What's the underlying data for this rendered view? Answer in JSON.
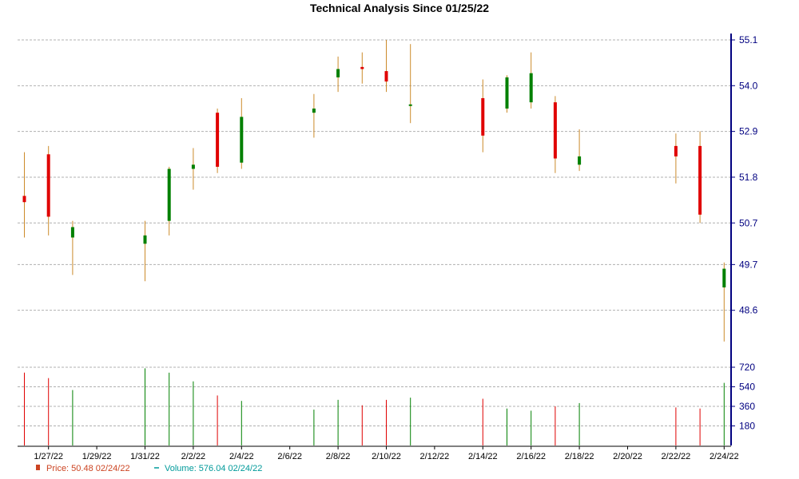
{
  "chart_data": {
    "type": "candlestick",
    "title": "Technical Analysis Since 01/25/22",
    "colors": {
      "up": "#008000",
      "down": "#e00000",
      "wick": "#cc8a2a",
      "grid": "#b0b0b0",
      "axis": "#000080"
    },
    "price_axis": {
      "ylim": [
        47.5,
        55.1
      ],
      "ticks": [
        "55.1",
        "54.0",
        "52.9",
        "51.8",
        "50.7",
        "49.7",
        "48.6"
      ]
    },
    "volume_axis": {
      "ylim": [
        0,
        720
      ],
      "ticks": [
        "720",
        "540",
        "360",
        "180"
      ]
    },
    "x_tick_labels": [
      "1/27/22",
      "1/29/22",
      "1/31/22",
      "2/2/22",
      "2/4/22",
      "2/6/22",
      "2/8/22",
      "2/10/22",
      "2/12/22",
      "2/14/22",
      "2/16/22",
      "2/18/22",
      "2/20/22",
      "2/22/22",
      "2/24/22"
    ],
    "candles": [
      {
        "date": "1/26/22",
        "open": 51.35,
        "high": 52.4,
        "low": 50.35,
        "close": 51.2,
        "volume": 670
      },
      {
        "date": "1/27/22",
        "open": 52.35,
        "high": 52.55,
        "low": 50.4,
        "close": 50.85,
        "volume": 620
      },
      {
        "date": "1/28/22",
        "open": 50.35,
        "high": 50.75,
        "low": 49.45,
        "close": 50.6,
        "volume": 510
      },
      {
        "date": "1/31/22",
        "open": 50.2,
        "high": 50.75,
        "low": 49.3,
        "close": 50.4,
        "volume": 710
      },
      {
        "date": "2/1/22",
        "open": 50.75,
        "high": 52.05,
        "low": 50.4,
        "close": 52.0,
        "volume": 670
      },
      {
        "date": "2/2/22",
        "open": 52.0,
        "high": 52.5,
        "low": 51.5,
        "close": 52.1,
        "volume": 590
      },
      {
        "date": "2/3/22",
        "open": 53.35,
        "high": 53.45,
        "low": 51.9,
        "close": 52.05,
        "volume": 460
      },
      {
        "date": "2/4/22",
        "open": 52.15,
        "high": 53.7,
        "low": 52.0,
        "close": 53.25,
        "volume": 410
      },
      {
        "date": "2/7/22",
        "open": 53.35,
        "high": 53.8,
        "low": 52.75,
        "close": 53.45,
        "volume": 330
      },
      {
        "date": "2/8/22",
        "open": 54.2,
        "high": 54.7,
        "low": 53.85,
        "close": 54.4,
        "volume": 420
      },
      {
        "date": "2/9/22",
        "open": 54.45,
        "high": 54.8,
        "low": 54.05,
        "close": 54.4,
        "volume": 370
      },
      {
        "date": "2/10/22",
        "open": 54.35,
        "high": 55.1,
        "low": 53.85,
        "close": 54.1,
        "volume": 420
      },
      {
        "date": "2/11/22",
        "open": 53.55,
        "high": 55.0,
        "low": 53.1,
        "close": 53.55,
        "volume": 440
      },
      {
        "date": "2/14/22",
        "open": 53.7,
        "high": 54.15,
        "low": 52.4,
        "close": 52.8,
        "volume": 430
      },
      {
        "date": "2/15/22",
        "open": 53.45,
        "high": 54.25,
        "low": 53.35,
        "close": 54.2,
        "volume": 340
      },
      {
        "date": "2/16/22",
        "open": 53.6,
        "high": 54.8,
        "low": 53.45,
        "close": 54.3,
        "volume": 320
      },
      {
        "date": "2/17/22",
        "open": 53.6,
        "high": 53.75,
        "low": 51.9,
        "close": 52.25,
        "volume": 360
      },
      {
        "date": "2/18/22",
        "open": 52.1,
        "high": 52.95,
        "low": 51.95,
        "close": 52.3,
        "volume": 390
      },
      {
        "date": "2/22/22",
        "open": 52.55,
        "high": 52.85,
        "low": 51.65,
        "close": 52.3,
        "volume": 350
      },
      {
        "date": "2/23/22",
        "open": 52.55,
        "high": 52.9,
        "low": 50.7,
        "close": 50.9,
        "volume": 340
      },
      {
        "date": "2/24/22",
        "open": 49.15,
        "high": 49.75,
        "low": 47.85,
        "close": 49.6,
        "volume": 576.04
      }
    ],
    "legend": [
      {
        "label": "Price: 50.48  02/24/22",
        "color": "#cc4422"
      },
      {
        "label": "Volume: 576.04  02/24/22",
        "color": "#009a9a"
      }
    ]
  }
}
